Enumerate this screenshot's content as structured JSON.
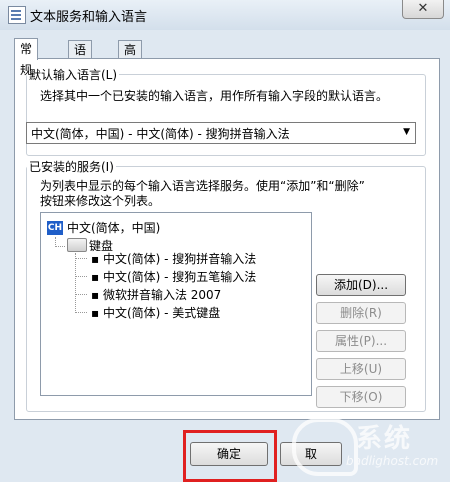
{
  "window": {
    "title": "文本服务和输入语言",
    "close_glyph": "✕"
  },
  "tabs": [
    {
      "label": "常规",
      "active": true
    },
    {
      "label": "语言栏",
      "active": false
    },
    {
      "label": "高级键设置",
      "active": false
    }
  ],
  "default_language": {
    "legend": "默认输入语言(L)",
    "description": "选择其中一个已安装的输入语言，用作所有输入字段的默认语言。",
    "selected": "中文(简体，中国) - 中文(简体) - 搜狗拼音输入法"
  },
  "installed_services": {
    "legend": "已安装的服务(I)",
    "description_line1": "为列表中显示的每个输入语言选择服务。使用“添加”和“删除”",
    "description_line2": "按钮来修改这个列表。",
    "tree": {
      "language_badge": "CH",
      "language": "中文(简体，中国)",
      "category": "键盘",
      "items": [
        "中文(简体) - 搜狗拼音输入法",
        "中文(简体) - 搜狗五笔输入法",
        "微软拼音输入法 2007",
        "中文(简体) - 美式键盘"
      ]
    },
    "buttons": {
      "add": "添加(D)...",
      "remove": "删除(R)",
      "properties": "属性(P)...",
      "move_up": "上移(U)",
      "move_down": "下移(O)"
    }
  },
  "footer": {
    "ok": "确定",
    "cancel": "取"
  },
  "watermark": {
    "logo_text": "系统",
    "url": "badlighost.com"
  },
  "colors": {
    "highlight": "#e02020",
    "language_badge": "#1f5ec8"
  }
}
